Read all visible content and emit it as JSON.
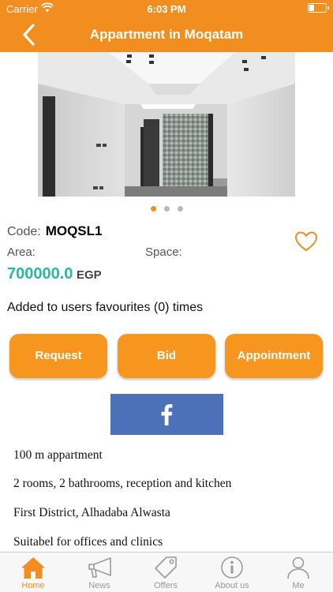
{
  "status_bar": {
    "carrier": "Carrier",
    "time": "6:03 PM"
  },
  "nav": {
    "title": "Appartment in Moqatam",
    "back_icon": "chevron-left-icon"
  },
  "carousel": {
    "total": 3,
    "active_index": 0
  },
  "listing": {
    "code_label": "Code:",
    "code_value": "MOQSL1",
    "area_label": "Area:",
    "space_label": "Space:",
    "price": "700000.0",
    "currency": "EGP",
    "favourites_text": "Added to users favourites (0) times"
  },
  "actions": {
    "request": "Request",
    "bid": "Bid",
    "appointment": "Appointment"
  },
  "share": {
    "icon": "facebook-icon"
  },
  "description": [
    "100 m appartment",
    "2 rooms, 2 bathrooms, reception and kitchen",
    "First District, Alhadaba Alwasta",
    "Suitabel for offices and clinics"
  ],
  "tabs": [
    {
      "label": "Home",
      "icon": "home-icon",
      "active": true
    },
    {
      "label": "News",
      "icon": "megaphone-icon",
      "active": false
    },
    {
      "label": "Offers",
      "icon": "tag-icon",
      "active": false
    },
    {
      "label": "About us",
      "icon": "info-icon",
      "active": false
    },
    {
      "label": "Me",
      "icon": "user-icon",
      "active": false
    }
  ],
  "colors": {
    "brand": "#f28d1f",
    "price": "#2bb8a2",
    "facebook": "#4c71b8"
  }
}
